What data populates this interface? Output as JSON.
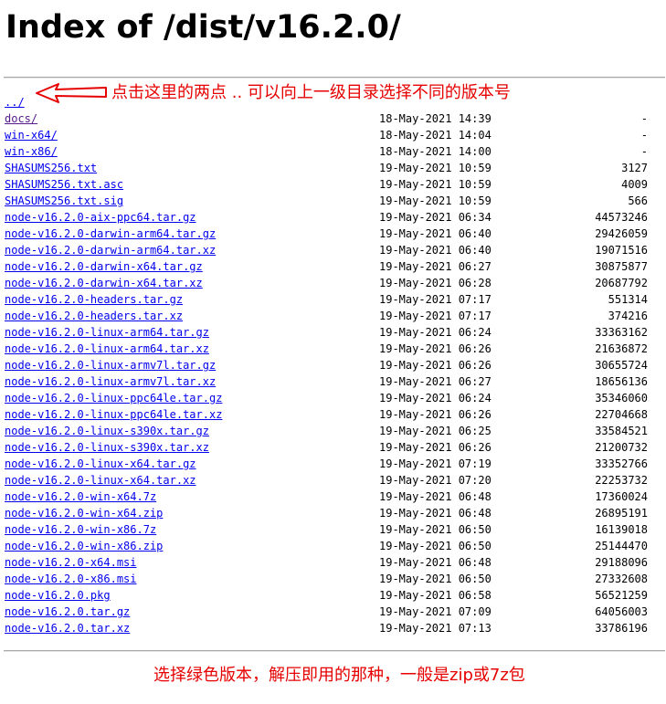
{
  "page": {
    "title": "Index of /dist/v16.2.0/"
  },
  "annotations": {
    "top_note": "点击这里的两点 .. 可以向上一级目录选择不同的版本号",
    "bottom_note": "选择绿色版本，解压即用的那种，一般是zip或7z包",
    "accent_color": "#e60000",
    "arrow_icon": "left-arrow-icon"
  },
  "colors": {
    "link": "#0000ee",
    "visited_link": "#551a8b"
  },
  "listing": {
    "parent_link": "../",
    "entries": [
      {
        "name": "docs/",
        "date": "18-May-2021 14:39",
        "size": "-",
        "visited": true
      },
      {
        "name": "win-x64/",
        "date": "18-May-2021 14:04",
        "size": "-"
      },
      {
        "name": "win-x86/",
        "date": "18-May-2021 14:00",
        "size": "-"
      },
      {
        "name": "SHASUMS256.txt",
        "date": "19-May-2021 10:59",
        "size": "3127"
      },
      {
        "name": "SHASUMS256.txt.asc",
        "date": "19-May-2021 10:59",
        "size": "4009"
      },
      {
        "name": "SHASUMS256.txt.sig",
        "date": "19-May-2021 10:59",
        "size": "566"
      },
      {
        "name": "node-v16.2.0-aix-ppc64.tar.gz",
        "date": "19-May-2021 06:34",
        "size": "44573246"
      },
      {
        "name": "node-v16.2.0-darwin-arm64.tar.gz",
        "date": "19-May-2021 06:40",
        "size": "29426059"
      },
      {
        "name": "node-v16.2.0-darwin-arm64.tar.xz",
        "date": "19-May-2021 06:40",
        "size": "19071516"
      },
      {
        "name": "node-v16.2.0-darwin-x64.tar.gz",
        "date": "19-May-2021 06:27",
        "size": "30875877"
      },
      {
        "name": "node-v16.2.0-darwin-x64.tar.xz",
        "date": "19-May-2021 06:28",
        "size": "20687792"
      },
      {
        "name": "node-v16.2.0-headers.tar.gz",
        "date": "19-May-2021 07:17",
        "size": "551314"
      },
      {
        "name": "node-v16.2.0-headers.tar.xz",
        "date": "19-May-2021 07:17",
        "size": "374216"
      },
      {
        "name": "node-v16.2.0-linux-arm64.tar.gz",
        "date": "19-May-2021 06:24",
        "size": "33363162"
      },
      {
        "name": "node-v16.2.0-linux-arm64.tar.xz",
        "date": "19-May-2021 06:26",
        "size": "21636872"
      },
      {
        "name": "node-v16.2.0-linux-armv7l.tar.gz",
        "date": "19-May-2021 06:26",
        "size": "30655724"
      },
      {
        "name": "node-v16.2.0-linux-armv7l.tar.xz",
        "date": "19-May-2021 06:27",
        "size": "18656136"
      },
      {
        "name": "node-v16.2.0-linux-ppc64le.tar.gz",
        "date": "19-May-2021 06:24",
        "size": "35346060"
      },
      {
        "name": "node-v16.2.0-linux-ppc64le.tar.xz",
        "date": "19-May-2021 06:26",
        "size": "22704668"
      },
      {
        "name": "node-v16.2.0-linux-s390x.tar.gz",
        "date": "19-May-2021 06:25",
        "size": "33584521"
      },
      {
        "name": "node-v16.2.0-linux-s390x.tar.xz",
        "date": "19-May-2021 06:26",
        "size": "21200732"
      },
      {
        "name": "node-v16.2.0-linux-x64.tar.gz",
        "date": "19-May-2021 07:19",
        "size": "33352766"
      },
      {
        "name": "node-v16.2.0-linux-x64.tar.xz",
        "date": "19-May-2021 07:20",
        "size": "22253732"
      },
      {
        "name": "node-v16.2.0-win-x64.7z",
        "date": "19-May-2021 06:48",
        "size": "17360024"
      },
      {
        "name": "node-v16.2.0-win-x64.zip",
        "date": "19-May-2021 06:48",
        "size": "26895191"
      },
      {
        "name": "node-v16.2.0-win-x86.7z",
        "date": "19-May-2021 06:50",
        "size": "16139018"
      },
      {
        "name": "node-v16.2.0-win-x86.zip",
        "date": "19-May-2021 06:50",
        "size": "25144470"
      },
      {
        "name": "node-v16.2.0-x64.msi",
        "date": "19-May-2021 06:48",
        "size": "29188096"
      },
      {
        "name": "node-v16.2.0-x86.msi",
        "date": "19-May-2021 06:50",
        "size": "27332608"
      },
      {
        "name": "node-v16.2.0.pkg",
        "date": "19-May-2021 06:58",
        "size": "56521259"
      },
      {
        "name": "node-v16.2.0.tar.gz",
        "date": "19-May-2021 07:09",
        "size": "64056003"
      },
      {
        "name": "node-v16.2.0.tar.xz",
        "date": "19-May-2021 07:13",
        "size": "33786196"
      }
    ]
  }
}
